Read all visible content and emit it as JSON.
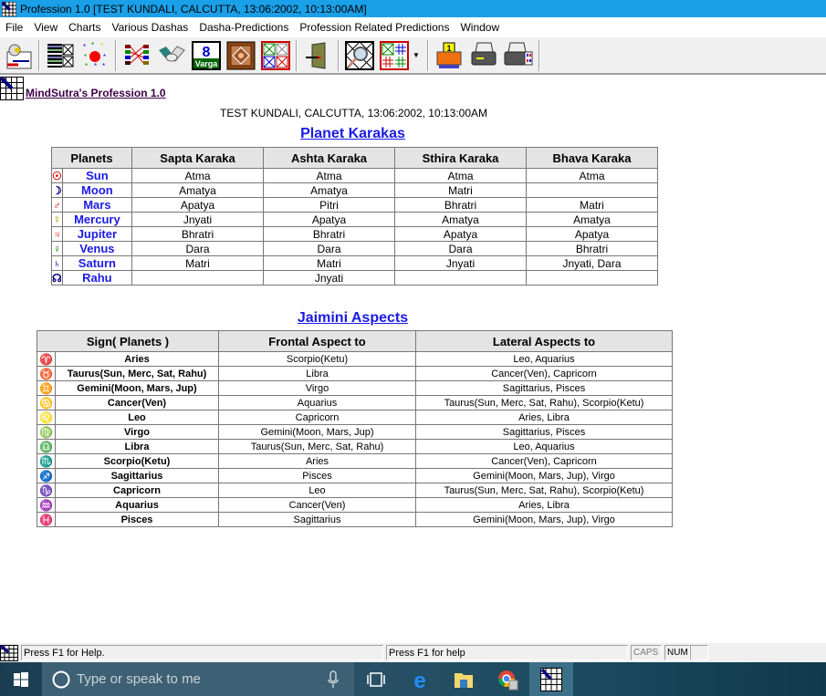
{
  "window": {
    "title": "Profession 1.0 [TEST KUNDALI, CALCUTTA, 13:06:2002, 10:13:00AM]"
  },
  "menu": [
    "File",
    "View",
    "Charts",
    "Various Dashas",
    "Dasha-Predictions",
    "Profession Related Predictions",
    "Window"
  ],
  "toolbar": {
    "buttons": [
      "profile-icon",
      "chart-list-icon",
      "stars-icon",
      "dasha-lines-icon",
      "handshake-icon",
      "varga-icon",
      "mandala-icon",
      "four-charts-icon",
      "exit-door-icon",
      "zoom-chart-icon",
      "chart-grid-icon",
      "print-one-icon",
      "print-icon",
      "print-color-icon"
    ],
    "varga_label": "Varga",
    "varga_number": "8",
    "print_number": "1"
  },
  "page": {
    "brand": "MindSutra's Profession 1.0",
    "subtitle": "TEST KUNDALI, CALCUTTA, 13:06:2002, 10:13:00AM"
  },
  "karakas": {
    "title": "Planet Karakas",
    "headers": [
      "Planets",
      "Sapta Karaka",
      "Ashta Karaka",
      "Sthira Karaka",
      "Bhava Karaka"
    ],
    "rows": [
      {
        "symbol": "☉",
        "color": "#e00000",
        "planet": "Sun",
        "sapta": "Atma",
        "ashta": "Atma",
        "sthira": "Atma",
        "bhava": "Atma"
      },
      {
        "symbol": "☽",
        "color": "#000080",
        "planet": "Moon",
        "sapta": "Amatya",
        "ashta": "Amatya",
        "sthira": "Matri",
        "bhava": ""
      },
      {
        "symbol": "♂",
        "color": "#e00000",
        "planet": "Mars",
        "sapta": "Apatya",
        "ashta": "Pitri",
        "sthira": "Bhratri",
        "bhava": "Matri"
      },
      {
        "symbol": "☿",
        "color": "#a0a000",
        "planet": "Mercury",
        "sapta": "Jnyati",
        "ashta": "Apatya",
        "sthira": "Amatya",
        "bhava": "Amatya"
      },
      {
        "symbol": "♃",
        "color": "#e00000",
        "planet": "Jupiter",
        "sapta": "Bhratri",
        "ashta": "Bhratri",
        "sthira": "Apatya",
        "bhava": "Apatya"
      },
      {
        "symbol": "♀",
        "color": "#008000",
        "planet": "Venus",
        "sapta": "Dara",
        "ashta": "Dara",
        "sthira": "Dara",
        "bhava": "Bhratri"
      },
      {
        "symbol": "♄",
        "color": "#000080",
        "planet": "Saturn",
        "sapta": "Matri",
        "ashta": "Matri",
        "sthira": "Jnyati",
        "bhava": "Jnyati, Dara"
      },
      {
        "symbol": "☊",
        "color": "#000080",
        "planet": "Rahu",
        "sapta": "",
        "ashta": "Jnyati",
        "sthira": "",
        "bhava": ""
      }
    ]
  },
  "aspects": {
    "title": "Jaimini Aspects",
    "headers": [
      "Sign( Planets )",
      "Frontal Aspect to",
      "Lateral Aspects to"
    ],
    "rows": [
      {
        "symbol": "♈",
        "color": "#e00000",
        "sign": "Aries",
        "frontal": "Scorpio(Ketu)",
        "lateral": "Leo, Aquarius"
      },
      {
        "symbol": "♉",
        "color": "#00b000",
        "sign": "Taurus(Sun, Merc, Sat, Rahu)",
        "frontal": "Libra",
        "lateral": "Cancer(Ven), Capricorn"
      },
      {
        "symbol": "♊",
        "color": "#808000",
        "sign": "Gemini(Moon, Mars, Jup)",
        "frontal": "Virgo",
        "lateral": "Sagittarius, Pisces"
      },
      {
        "symbol": "♋",
        "color": "#000080",
        "sign": "Cancer(Ven)",
        "frontal": "Aquarius",
        "lateral": "Taurus(Sun, Merc, Sat, Rahu), Scorpio(Ketu)"
      },
      {
        "symbol": "♌",
        "color": "#e00000",
        "sign": "Leo",
        "frontal": "Capricorn",
        "lateral": "Aries, Libra"
      },
      {
        "symbol": "♍",
        "color": "#00a000",
        "sign": "Virgo",
        "frontal": "Gemini(Moon, Mars, Jup)",
        "lateral": "Sagittarius, Pisces"
      },
      {
        "symbol": "♎",
        "color": "#c0c000",
        "sign": "Libra",
        "frontal": "Taurus(Sun, Merc, Sat, Rahu)",
        "lateral": "Leo, Aquarius"
      },
      {
        "symbol": "♏",
        "color": "#0000c0",
        "sign": "Scorpio(Ketu)",
        "frontal": "Aries",
        "lateral": "Cancer(Ven), Capricorn"
      },
      {
        "symbol": "♐",
        "color": "#c0c000",
        "sign": "Sagittarius",
        "frontal": "Pisces",
        "lateral": "Gemini(Moon, Mars, Jup), Virgo"
      },
      {
        "symbol": "♑",
        "color": "#00a000",
        "sign": "Capricorn",
        "frontal": "Leo",
        "lateral": "Taurus(Sun, Merc, Sat, Rahu), Scorpio(Ketu)"
      },
      {
        "symbol": "♒",
        "color": "#808000",
        "sign": "Aquarius",
        "frontal": "Cancer(Ven)",
        "lateral": "Aries, Libra"
      },
      {
        "symbol": "♓",
        "color": "#0000a0",
        "sign": "Pisces",
        "frontal": "Sagittarius",
        "lateral": "Gemini(Moon, Mars, Jup), Virgo"
      }
    ]
  },
  "status": {
    "left": "Press F1 for Help.",
    "middle": "Press F1 for help",
    "caps": "CAPS",
    "num": "NUM"
  },
  "taskbar": {
    "search_placeholder": "Type or speak to me"
  }
}
